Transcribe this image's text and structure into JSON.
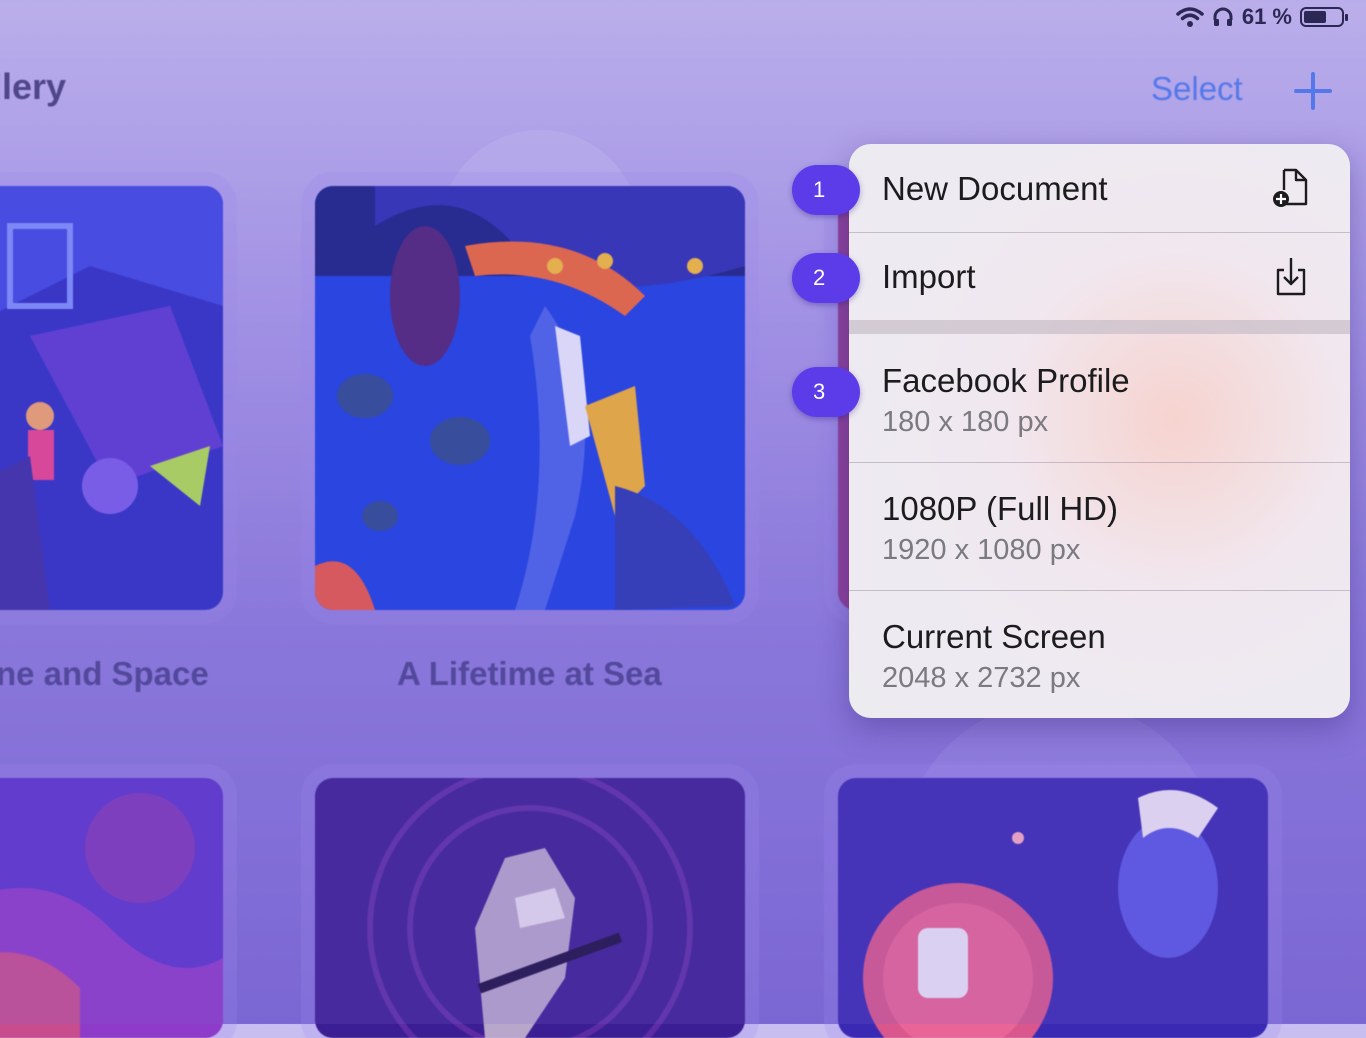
{
  "status_bar": {
    "battery_text": "61 %",
    "battery_level": 0.61
  },
  "nav": {
    "title": "llery",
    "select_label": "Select",
    "add_icon": "plus-icon"
  },
  "gallery": {
    "row1": [
      {
        "title": "ne and Space"
      },
      {
        "title": "A Lifetime at Sea"
      }
    ]
  },
  "menu": {
    "items": [
      {
        "label": "New Document",
        "icon": "new-document-icon"
      },
      {
        "label": "Import",
        "icon": "import-icon"
      },
      {
        "label": "Facebook Profile",
        "subtitle": "180 x 180 px"
      },
      {
        "label": "1080P (Full HD)",
        "subtitle": "1920 x 1080 px"
      },
      {
        "label": "Current Screen",
        "subtitle": "2048 x 2732 px"
      }
    ]
  },
  "badges": [
    "1",
    "2",
    "3"
  ]
}
